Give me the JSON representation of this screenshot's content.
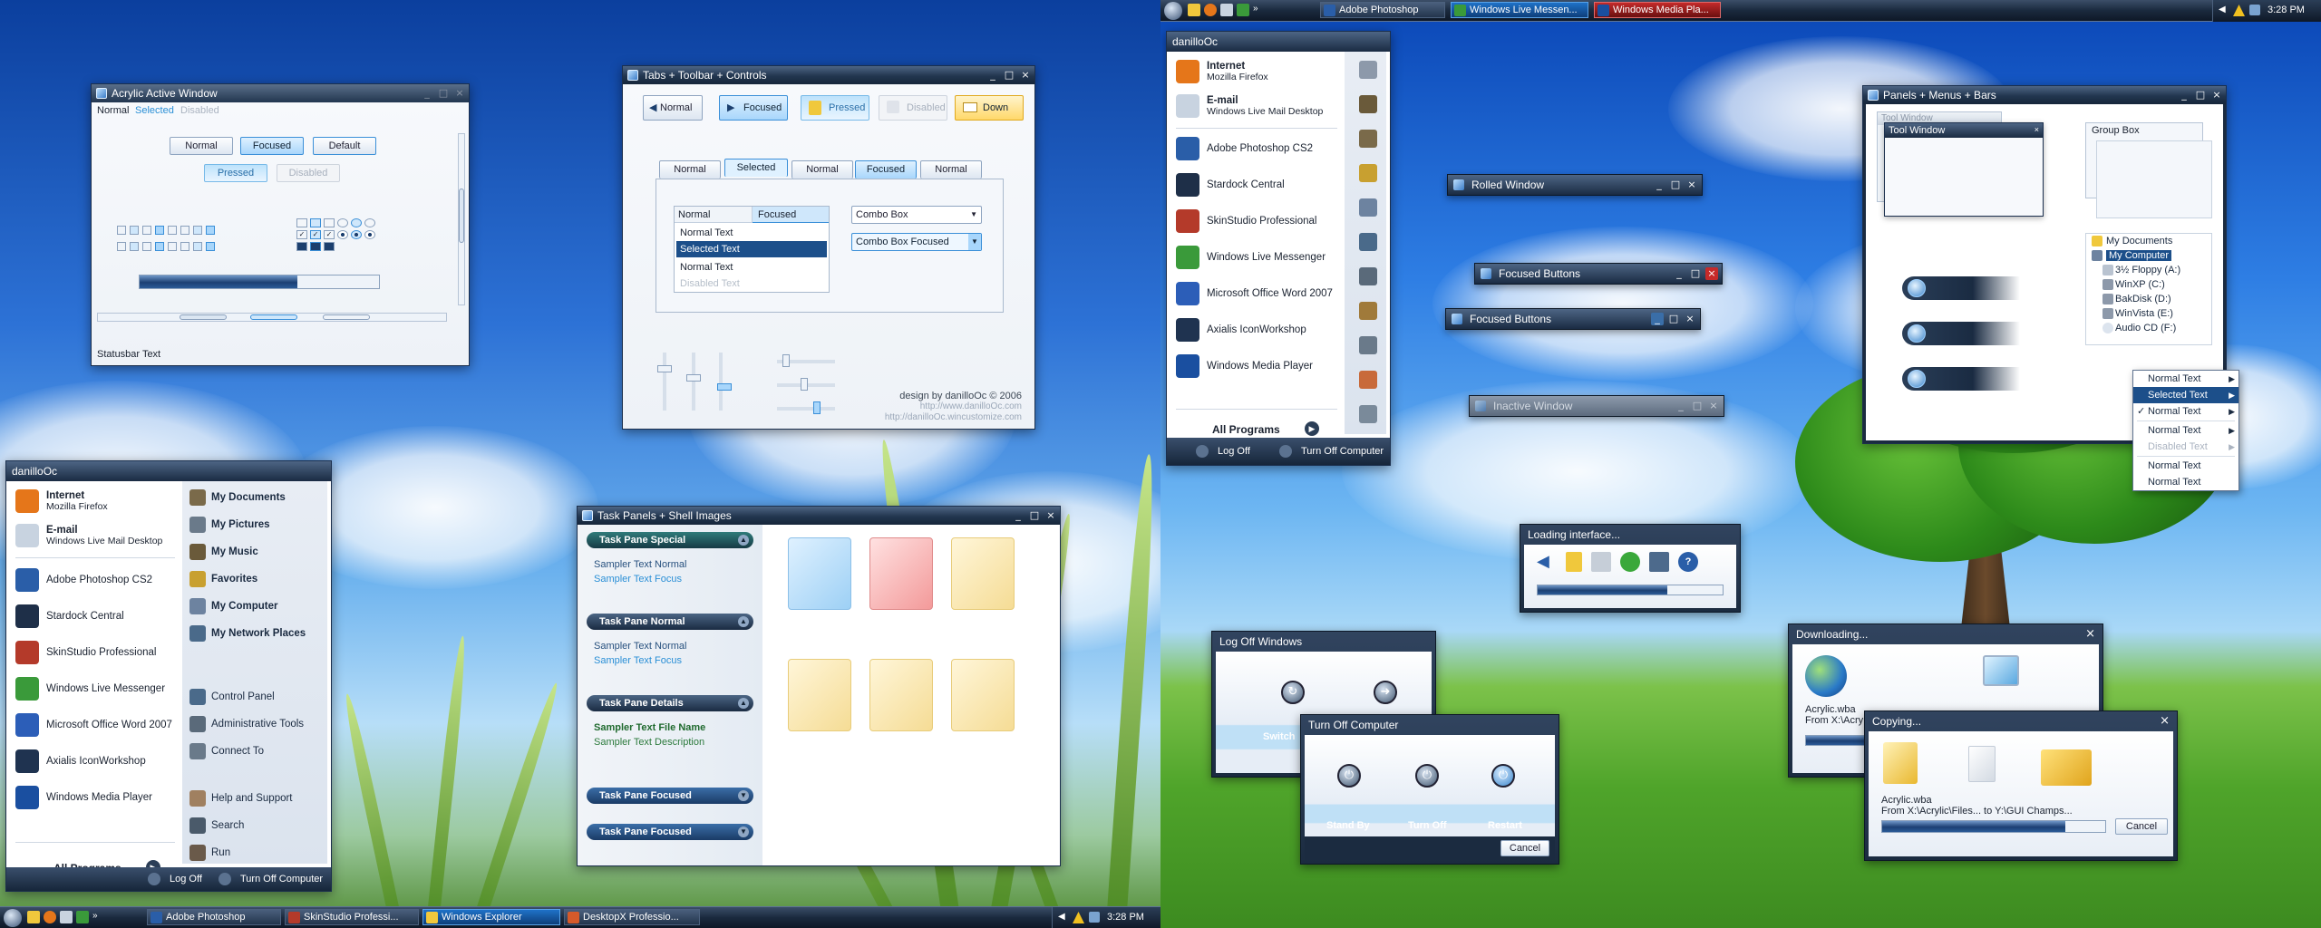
{
  "left": {
    "acrylic": {
      "title": "Acrylic Active Window",
      "menu": [
        "Normal",
        "Selected",
        "Disabled"
      ],
      "buttons": [
        "Normal",
        "Focused",
        "Default",
        "Pressed",
        "Disabled"
      ],
      "statusbar": "Statusbar Text",
      "progress_fraction": 0.66
    },
    "tabs": {
      "title": "Tabs + Toolbar + Controls",
      "toolbar": [
        "Normal",
        "Focused",
        "Pressed",
        "Disabled",
        "Down"
      ],
      "tabs": [
        "Normal",
        "Selected",
        "Normal",
        "Focused",
        "Normal"
      ],
      "list_header": [
        "Normal",
        "Focused"
      ],
      "list_items": [
        "Normal Text",
        "Selected Text",
        "Normal Text",
        "Disabled Text"
      ],
      "combo1": "Combo Box",
      "combo2": "Combo Box Focused",
      "credit1": "design by danilloOc © 2006",
      "credit2": "http://www.danilloOc.com",
      "credit3": "http://danilloOc.wincustomize.com"
    },
    "start": {
      "user": "danilloOc",
      "pinned": [
        {
          "l1": "Internet",
          "l2": "Mozilla Firefox",
          "color": "#e5761a"
        },
        {
          "l1": "E-mail",
          "l2": "Windows Live Mail Desktop",
          "color": "#c8d3e0"
        }
      ],
      "programs": [
        {
          "label": "Adobe Photoshop CS2",
          "color": "#2a5ea8"
        },
        {
          "label": "Stardock Central",
          "color": "#1e2f48"
        },
        {
          "label": "SkinStudio Professional",
          "color": "#b43a2a"
        },
        {
          "label": "Windows Live Messenger",
          "color": "#3a9a3a"
        },
        {
          "label": "Microsoft Office Word 2007",
          "color": "#2c5eb8"
        },
        {
          "label": "Axialis IconWorkshop",
          "color": "#1f3350"
        },
        {
          "label": "Windows Media Player",
          "color": "#1a4fa0"
        }
      ],
      "all_programs": "All Programs",
      "right": [
        "My Documents",
        "My Pictures",
        "My Music",
        "Favorites",
        "My Computer",
        "My Network Places"
      ],
      "right2": [
        "Control Panel",
        "Administrative Tools",
        "Connect To"
      ],
      "right3": [
        "Help and Support",
        "Search",
        "Run"
      ],
      "logoff": "Log Off",
      "turnoff": "Turn Off Computer"
    },
    "taskpanels": {
      "title": "Task Panels + Shell Images",
      "panes": [
        {
          "head": "Task Pane Special",
          "links": [
            "Sampler Text Normal",
            "Sampler Text Focus"
          ]
        },
        {
          "head": "Task Pane Normal",
          "links": [
            "Sampler Text Normal",
            "Sampler Text Focus"
          ]
        },
        {
          "head": "Task Pane Details",
          "links": [
            "Sampler Text File Name",
            "Sampler Text Description"
          ]
        },
        {
          "head": "Task Pane Focused",
          "links": []
        },
        {
          "head": "Task Pane Focused",
          "links": []
        }
      ]
    },
    "taskbar": {
      "buttons": [
        "Adobe Photoshop",
        "SkinStudio Professi...",
        "Windows Explorer",
        "DesktopX Professio..."
      ],
      "clock": "3:28 PM"
    }
  },
  "right": {
    "taskbar": {
      "buttons": [
        "Adobe Photoshop",
        "Windows Live Messen...",
        "Windows Media Pla..."
      ],
      "clock": "3:28 PM"
    },
    "start": {
      "user": "danilloOc",
      "pinned": [
        {
          "l1": "Internet",
          "l2": "Mozilla Firefox",
          "color": "#e5761a"
        },
        {
          "l1": "E-mail",
          "l2": "Windows Live Mail Desktop",
          "color": "#c8d3e0"
        }
      ],
      "programs": [
        {
          "label": "Adobe Photoshop CS2",
          "color": "#2a5ea8"
        },
        {
          "label": "Stardock Central",
          "color": "#1e2f48"
        },
        {
          "label": "SkinStudio Professional",
          "color": "#b43a2a"
        },
        {
          "label": "Windows Live Messenger",
          "color": "#3a9a3a"
        },
        {
          "label": "Microsoft Office Word 2007",
          "color": "#2c5eb8"
        },
        {
          "label": "Axialis IconWorkshop",
          "color": "#1f3350"
        },
        {
          "label": "Windows Media Player",
          "color": "#1a4fa0"
        }
      ],
      "all_programs": "All Programs",
      "logoff": "Log Off",
      "turnoff": "Turn Off Computer"
    },
    "rolled": "Rolled Window",
    "focused1": "Focused Buttons",
    "focused2": "Focused Buttons",
    "inactive": "Inactive Window",
    "loading": {
      "title": "Loading interface...",
      "progress_fraction": 0.7
    },
    "logoff": {
      "title": "Log Off Windows",
      "switch": "Switch"
    },
    "turnoff": {
      "title": "Turn Off Computer",
      "options": [
        "Stand By",
        "Turn Off",
        "Restart"
      ],
      "cancel": "Cancel"
    },
    "panels": {
      "title": "Panels + Menus + Bars",
      "tool1": "Tool Window",
      "tool2": "Tool Window",
      "group": "Group Box",
      "tree": [
        "My Documents",
        "My Computer",
        "3½ Floppy (A:)",
        "WinXP (C:)",
        "BakDisk (D:)",
        "WinVista (E:)",
        "Audio CD (F:)"
      ],
      "menu": [
        "Normal Text",
        "Selected Text",
        "Normal Text",
        "Normal Text",
        "Disabled Text",
        "Normal Text",
        "Normal Text"
      ]
    },
    "downloading": {
      "title": "Downloading...",
      "file": "Acrylic.wba",
      "from": "From X:\\Acry"
    },
    "copying": {
      "title": "Copying...",
      "file": "Acrylic.wba",
      "from": "From X:\\Acrylic\\Files... to Y:\\GUI Champs...",
      "progress_fraction": 0.82,
      "cancel": "Cancel"
    }
  }
}
